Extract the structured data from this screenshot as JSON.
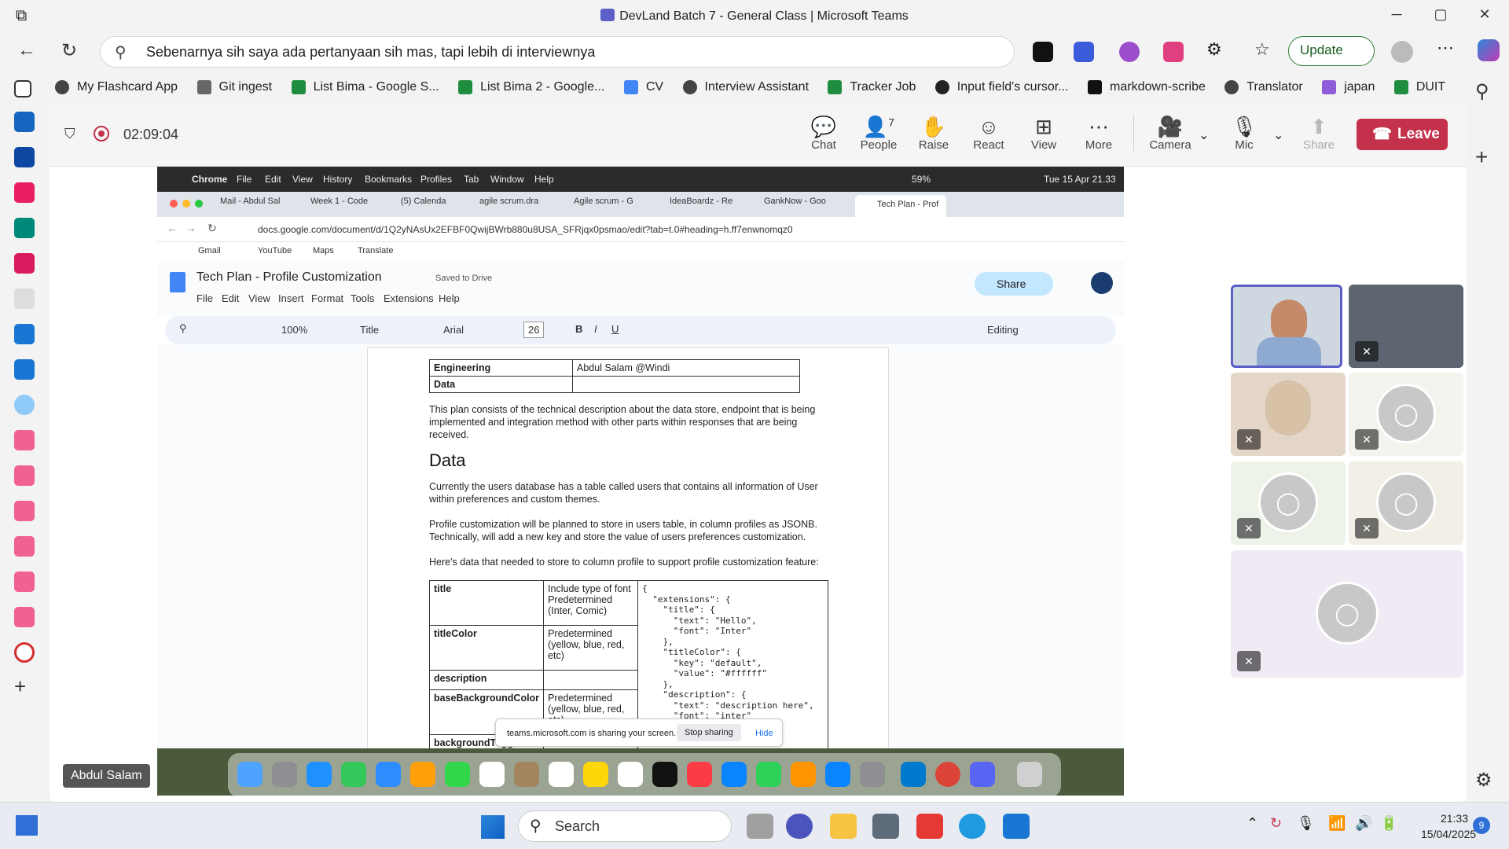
{
  "window": {
    "title": "DevLand Batch 7 - General Class | Microsoft Teams",
    "minimize": "─",
    "maximize": "▢",
    "close": "✕"
  },
  "browser": {
    "search_text": "Sebenarnya sih saya ada pertanyaan sih mas, tapi lebih di interviewnya",
    "update_label": "Update",
    "bookmarks": [
      "My Flashcard App",
      "Git ingest",
      "List Bima - Google S...",
      "List Bima 2 - Google...",
      "CV",
      "Interview Assistant",
      "Tracker Job",
      "Input field's cursor...",
      "markdown-scribe",
      "Translator",
      "japan",
      "DUIT"
    ]
  },
  "meeting": {
    "timer": "02:09:04",
    "chat": "Chat",
    "people": "People",
    "people_count": "7",
    "raise": "Raise",
    "react": "React",
    "view": "View",
    "more": "More",
    "camera": "Camera",
    "mic": "Mic",
    "share": "Share",
    "leave": "Leave",
    "presenter_name": "Abdul Salam"
  },
  "shared": {
    "mac_menu": [
      "Chrome",
      "File",
      "Edit",
      "View",
      "History",
      "Bookmarks",
      "Profiles",
      "Tab",
      "Window",
      "Help"
    ],
    "mac_status": "Tue 15 Apr 21.33",
    "battery": "59%",
    "tabs": [
      "Mail - Abdul Sal",
      "Week 1 - Code",
      "(5) Calenda",
      "agile scrum.dra",
      "Agile scrum - G",
      "IdeaBoardz - Re",
      "GankNow - Goo",
      "Tech Plan - Prof"
    ],
    "url": "docs.google.com/document/d/1Q2yNAsUx2EFBF0QwijBWrb880u8USA_SFRjqx0psmao/edit?tab=t.0#heading=h.ff7enwnomqz0",
    "bm_gmail": "Gmail",
    "bm_youtube": "YouTube",
    "bm_maps": "Maps",
    "bm_translate": "Translate",
    "doc_title": "Tech Plan - Profile Customization",
    "saved": "Saved to Drive",
    "doc_menu": [
      "File",
      "Edit",
      "View",
      "Insert",
      "Format",
      "Tools",
      "Extensions",
      "Help"
    ],
    "share_label": "Share",
    "zoom": "100%",
    "style": "Title",
    "font": "Arial",
    "font_size": "26",
    "editing": "Editing",
    "engineering_label": "Engineering",
    "engineering_value": "Abdul Salam @Windi",
    "data_row_label": "Data",
    "intro": "This plan consists of the technical description about the data store, endpoint that is being implemented and integration method with other parts within responses that are being received.",
    "data_heading": "Data",
    "p1": "Currently the users database has a table called users that contains all information of User within preferences and custom themes.",
    "p2": "Profile customization will be planned to store in users table, in column profiles as JSONB. Technically, will add a new key and store the value of users preferences customization.",
    "p3": "Here's data that needed to store to column profile to support profile customization feature:",
    "rows": [
      {
        "key": "title",
        "desc": "Include type of font Predetermined (Inter, Comic)"
      },
      {
        "key": "titleColor",
        "desc": "Predetermined (yellow, blue, red, etc)"
      },
      {
        "key": "description",
        "desc": ""
      },
      {
        "key": "baseBackgroundColor",
        "desc": "Predetermined (yellow, blue, red, etc)"
      },
      {
        "key": "backgroundToggle",
        "desc": ""
      }
    ],
    "code": "{\n  \"extensions\": {\n    \"title\": {\n      \"text\": \"Hello\",\n      \"font\": \"Inter\"\n    },\n    \"titleColor\": {\n      \"key\": \"default\",\n      \"value\": \"#ffffff\"\n    },\n    \"description\": {\n      \"text\": \"description here\",\n      \"font\": \"inter\"",
    "share_notice": "teams.microsoft.com is sharing your screen.",
    "stop_sharing": "Stop sharing",
    "hide": "Hide"
  },
  "taskbar": {
    "search": "Search",
    "time": "21:33",
    "date": "15/04/2025",
    "badge": "9"
  },
  "colors": {
    "leave": "#c4314b",
    "accent": "#5b5fc7",
    "update_border": "#2e7d32"
  }
}
